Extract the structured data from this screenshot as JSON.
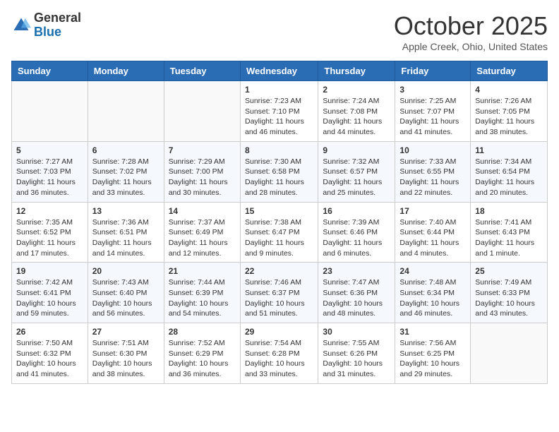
{
  "header": {
    "logo_general": "General",
    "logo_blue": "Blue",
    "month_title": "October 2025",
    "location": "Apple Creek, Ohio, United States"
  },
  "weekdays": [
    "Sunday",
    "Monday",
    "Tuesday",
    "Wednesday",
    "Thursday",
    "Friday",
    "Saturday"
  ],
  "weeks": [
    [
      {
        "day": "",
        "info": ""
      },
      {
        "day": "",
        "info": ""
      },
      {
        "day": "",
        "info": ""
      },
      {
        "day": "1",
        "info": "Sunrise: 7:23 AM\nSunset: 7:10 PM\nDaylight: 11 hours and 46 minutes."
      },
      {
        "day": "2",
        "info": "Sunrise: 7:24 AM\nSunset: 7:08 PM\nDaylight: 11 hours and 44 minutes."
      },
      {
        "day": "3",
        "info": "Sunrise: 7:25 AM\nSunset: 7:07 PM\nDaylight: 11 hours and 41 minutes."
      },
      {
        "day": "4",
        "info": "Sunrise: 7:26 AM\nSunset: 7:05 PM\nDaylight: 11 hours and 38 minutes."
      }
    ],
    [
      {
        "day": "5",
        "info": "Sunrise: 7:27 AM\nSunset: 7:03 PM\nDaylight: 11 hours and 36 minutes."
      },
      {
        "day": "6",
        "info": "Sunrise: 7:28 AM\nSunset: 7:02 PM\nDaylight: 11 hours and 33 minutes."
      },
      {
        "day": "7",
        "info": "Sunrise: 7:29 AM\nSunset: 7:00 PM\nDaylight: 11 hours and 30 minutes."
      },
      {
        "day": "8",
        "info": "Sunrise: 7:30 AM\nSunset: 6:58 PM\nDaylight: 11 hours and 28 minutes."
      },
      {
        "day": "9",
        "info": "Sunrise: 7:32 AM\nSunset: 6:57 PM\nDaylight: 11 hours and 25 minutes."
      },
      {
        "day": "10",
        "info": "Sunrise: 7:33 AM\nSunset: 6:55 PM\nDaylight: 11 hours and 22 minutes."
      },
      {
        "day": "11",
        "info": "Sunrise: 7:34 AM\nSunset: 6:54 PM\nDaylight: 11 hours and 20 minutes."
      }
    ],
    [
      {
        "day": "12",
        "info": "Sunrise: 7:35 AM\nSunset: 6:52 PM\nDaylight: 11 hours and 17 minutes."
      },
      {
        "day": "13",
        "info": "Sunrise: 7:36 AM\nSunset: 6:51 PM\nDaylight: 11 hours and 14 minutes."
      },
      {
        "day": "14",
        "info": "Sunrise: 7:37 AM\nSunset: 6:49 PM\nDaylight: 11 hours and 12 minutes."
      },
      {
        "day": "15",
        "info": "Sunrise: 7:38 AM\nSunset: 6:47 PM\nDaylight: 11 hours and 9 minutes."
      },
      {
        "day": "16",
        "info": "Sunrise: 7:39 AM\nSunset: 6:46 PM\nDaylight: 11 hours and 6 minutes."
      },
      {
        "day": "17",
        "info": "Sunrise: 7:40 AM\nSunset: 6:44 PM\nDaylight: 11 hours and 4 minutes."
      },
      {
        "day": "18",
        "info": "Sunrise: 7:41 AM\nSunset: 6:43 PM\nDaylight: 11 hours and 1 minute."
      }
    ],
    [
      {
        "day": "19",
        "info": "Sunrise: 7:42 AM\nSunset: 6:41 PM\nDaylight: 10 hours and 59 minutes."
      },
      {
        "day": "20",
        "info": "Sunrise: 7:43 AM\nSunset: 6:40 PM\nDaylight: 10 hours and 56 minutes."
      },
      {
        "day": "21",
        "info": "Sunrise: 7:44 AM\nSunset: 6:39 PM\nDaylight: 10 hours and 54 minutes."
      },
      {
        "day": "22",
        "info": "Sunrise: 7:46 AM\nSunset: 6:37 PM\nDaylight: 10 hours and 51 minutes."
      },
      {
        "day": "23",
        "info": "Sunrise: 7:47 AM\nSunset: 6:36 PM\nDaylight: 10 hours and 48 minutes."
      },
      {
        "day": "24",
        "info": "Sunrise: 7:48 AM\nSunset: 6:34 PM\nDaylight: 10 hours and 46 minutes."
      },
      {
        "day": "25",
        "info": "Sunrise: 7:49 AM\nSunset: 6:33 PM\nDaylight: 10 hours and 43 minutes."
      }
    ],
    [
      {
        "day": "26",
        "info": "Sunrise: 7:50 AM\nSunset: 6:32 PM\nDaylight: 10 hours and 41 minutes."
      },
      {
        "day": "27",
        "info": "Sunrise: 7:51 AM\nSunset: 6:30 PM\nDaylight: 10 hours and 38 minutes."
      },
      {
        "day": "28",
        "info": "Sunrise: 7:52 AM\nSunset: 6:29 PM\nDaylight: 10 hours and 36 minutes."
      },
      {
        "day": "29",
        "info": "Sunrise: 7:54 AM\nSunset: 6:28 PM\nDaylight: 10 hours and 33 minutes."
      },
      {
        "day": "30",
        "info": "Sunrise: 7:55 AM\nSunset: 6:26 PM\nDaylight: 10 hours and 31 minutes."
      },
      {
        "day": "31",
        "info": "Sunrise: 7:56 AM\nSunset: 6:25 PM\nDaylight: 10 hours and 29 minutes."
      },
      {
        "day": "",
        "info": ""
      }
    ]
  ]
}
